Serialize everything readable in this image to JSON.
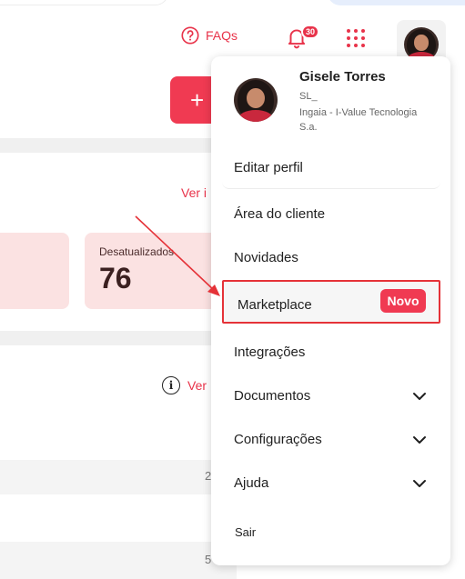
{
  "header": {
    "faq_label": "FAQs",
    "notification_count": "30"
  },
  "background": {
    "add_button_label": "+",
    "link_1": "Ver i",
    "card_label": "Desatualizados",
    "card_value": "76",
    "link_2": "Ver",
    "row_1_value": "2",
    "row_2_value": "5"
  },
  "profile": {
    "name": "Gisele Torres",
    "role": "SL_",
    "company": "Ingaia - I-Value Tecnologia S.a."
  },
  "menu": {
    "edit_profile": "Editar perfil",
    "client_area": "Área do cliente",
    "news": "Novidades",
    "marketplace": "Marketplace",
    "new_badge": "Novo",
    "integrations": "Integrações",
    "documents": "Documentos",
    "settings": "Configurações",
    "help": "Ajuda",
    "logout": "Sair"
  },
  "colors": {
    "accent": "#f03a52",
    "highlight_border": "#e53238",
    "card_bg": "#fbe2e2"
  }
}
